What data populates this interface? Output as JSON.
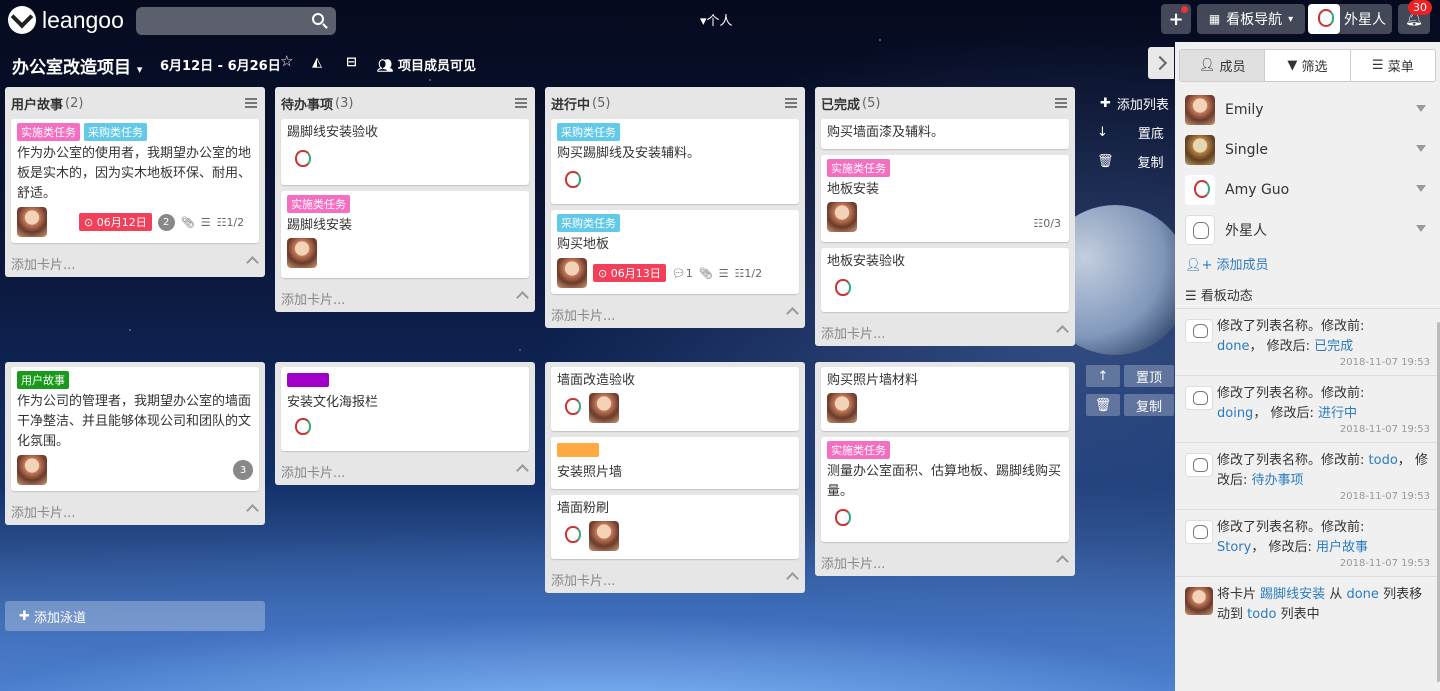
{
  "app": {
    "name": "leangoo",
    "search_placeholder": "",
    "personal_label": "个人",
    "board_nav_label": "看板导航",
    "user_name": "外星人",
    "notif_count": "30"
  },
  "board": {
    "title": "办公室改造项目",
    "dates": "6月12日 - 6月26日",
    "visibility": "项目成员可见"
  },
  "lists": [
    {
      "title": "用户故事",
      "count": "(2)",
      "add": "添加卡片...",
      "cards": [
        {
          "tags": [
            {
              "t": "实施类任务",
              "c": "#f56fc0"
            },
            {
              "t": "采购类任务",
              "c": "#62c9e8"
            }
          ],
          "text": "作为办公室的使用者，我期望办公室的地板是实木的，因为实木地板环保、耐用、舒适。",
          "due": "06月12日",
          "badge": "2",
          "check": "1/2"
        }
      ]
    },
    {
      "title": "待办事项",
      "count": "(3)",
      "add": "添加卡片...",
      "cards": [
        {
          "text": "踢脚线安装验收"
        },
        {
          "tags": [
            {
              "t": "实施类任务",
              "c": "#f56fc0"
            }
          ],
          "text": "踢脚线安装"
        }
      ]
    },
    {
      "title": "进行中",
      "count": "(5)",
      "add": "添加卡片...",
      "cards": [
        {
          "tags": [
            {
              "t": "采购类任务",
              "c": "#62c9e8"
            }
          ],
          "text": "购买踢脚线及安装辅料。"
        },
        {
          "tags": [
            {
              "t": "采购类任务",
              "c": "#62c9e8"
            }
          ],
          "text": "购买地板",
          "due": "06月13日",
          "comments": "1",
          "check": "1/2"
        }
      ]
    },
    {
      "title": "已完成",
      "count": "(5)",
      "add": "添加卡片...",
      "cards": [
        {
          "text": "购买墙面漆及辅料。"
        },
        {
          "tags": [
            {
              "t": "实施类任务",
              "c": "#f56fc0"
            }
          ],
          "text": "地板安装",
          "check": "0/3"
        },
        {
          "text": "地板安装验收"
        }
      ]
    }
  ],
  "lane2": [
    {
      "add": "添加卡片...",
      "cards": [
        {
          "tags": [
            {
              "t": "用户故事",
              "c": "#1a9a1a"
            }
          ],
          "text": "作为公司的管理者，我期望办公室的墙面干净整洁、并且能够体现公司和团队的文化氛围。",
          "badge": "3"
        }
      ]
    },
    {
      "add": "添加卡片...",
      "cards": [
        {
          "text": "安装文化海报栏"
        }
      ]
    },
    {
      "add": "添加卡片...",
      "cards": [
        {
          "text": "墙面改造验收"
        },
        {
          "text": "安装照片墙"
        },
        {
          "text": "墙面粉刷"
        }
      ]
    },
    {
      "add": "添加卡片...",
      "cards": [
        {
          "text": "购买照片墙材料"
        },
        {
          "tags": [
            {
              "t": "实施类任务",
              "c": "#f56fc0"
            }
          ],
          "text": "测量办公室面积、估算地板、踢脚线购买量。"
        }
      ]
    }
  ],
  "side_actions": {
    "add_list": "添加列表",
    "top": "置底",
    "copy": "复制",
    "lane_top": "置顶",
    "lane_copy": "复制"
  },
  "add_swimlane": "添加泳道",
  "panel": {
    "tabs": [
      "成员",
      "筛选",
      "菜单"
    ],
    "members": [
      "Emily",
      "Single",
      "Amy Guo",
      "外星人"
    ],
    "add_member": "添加成员",
    "activity_title": "看板动态",
    "activities": [
      {
        "text": "修改了列表名称。修改前:",
        "before": "done",
        "after_label": "修改后:",
        "after": "已完成",
        "time": "2018-11-07 19:53"
      },
      {
        "text": "修改了列表名称。修改前:",
        "before": "doing",
        "after_label": "修改后:",
        "after": "进行中",
        "time": "2018-11-07 19:53"
      },
      {
        "text": "修改了列表名称。修改前:",
        "before": "todo",
        "after_label": "修改后:",
        "after": "待办事项",
        "time": "2018-11-07 19:53"
      },
      {
        "text": "修改了列表名称。修改前:",
        "before": "Story",
        "after_label": "修改后:",
        "after": "用户故事",
        "time": "2018-11-07 19:53"
      }
    ],
    "last_activity": {
      "p1": "将卡片",
      "card": "踢脚线安装",
      "p2": "从",
      "from": "done",
      "p3": "列表移动到",
      "to": "todo",
      "p4": "列表中"
    }
  },
  "colors": {
    "due": "#f2405a",
    "link": "#2b7bbf",
    "orange_label": "#ffa940",
    "purple_label": "#a000c8"
  }
}
